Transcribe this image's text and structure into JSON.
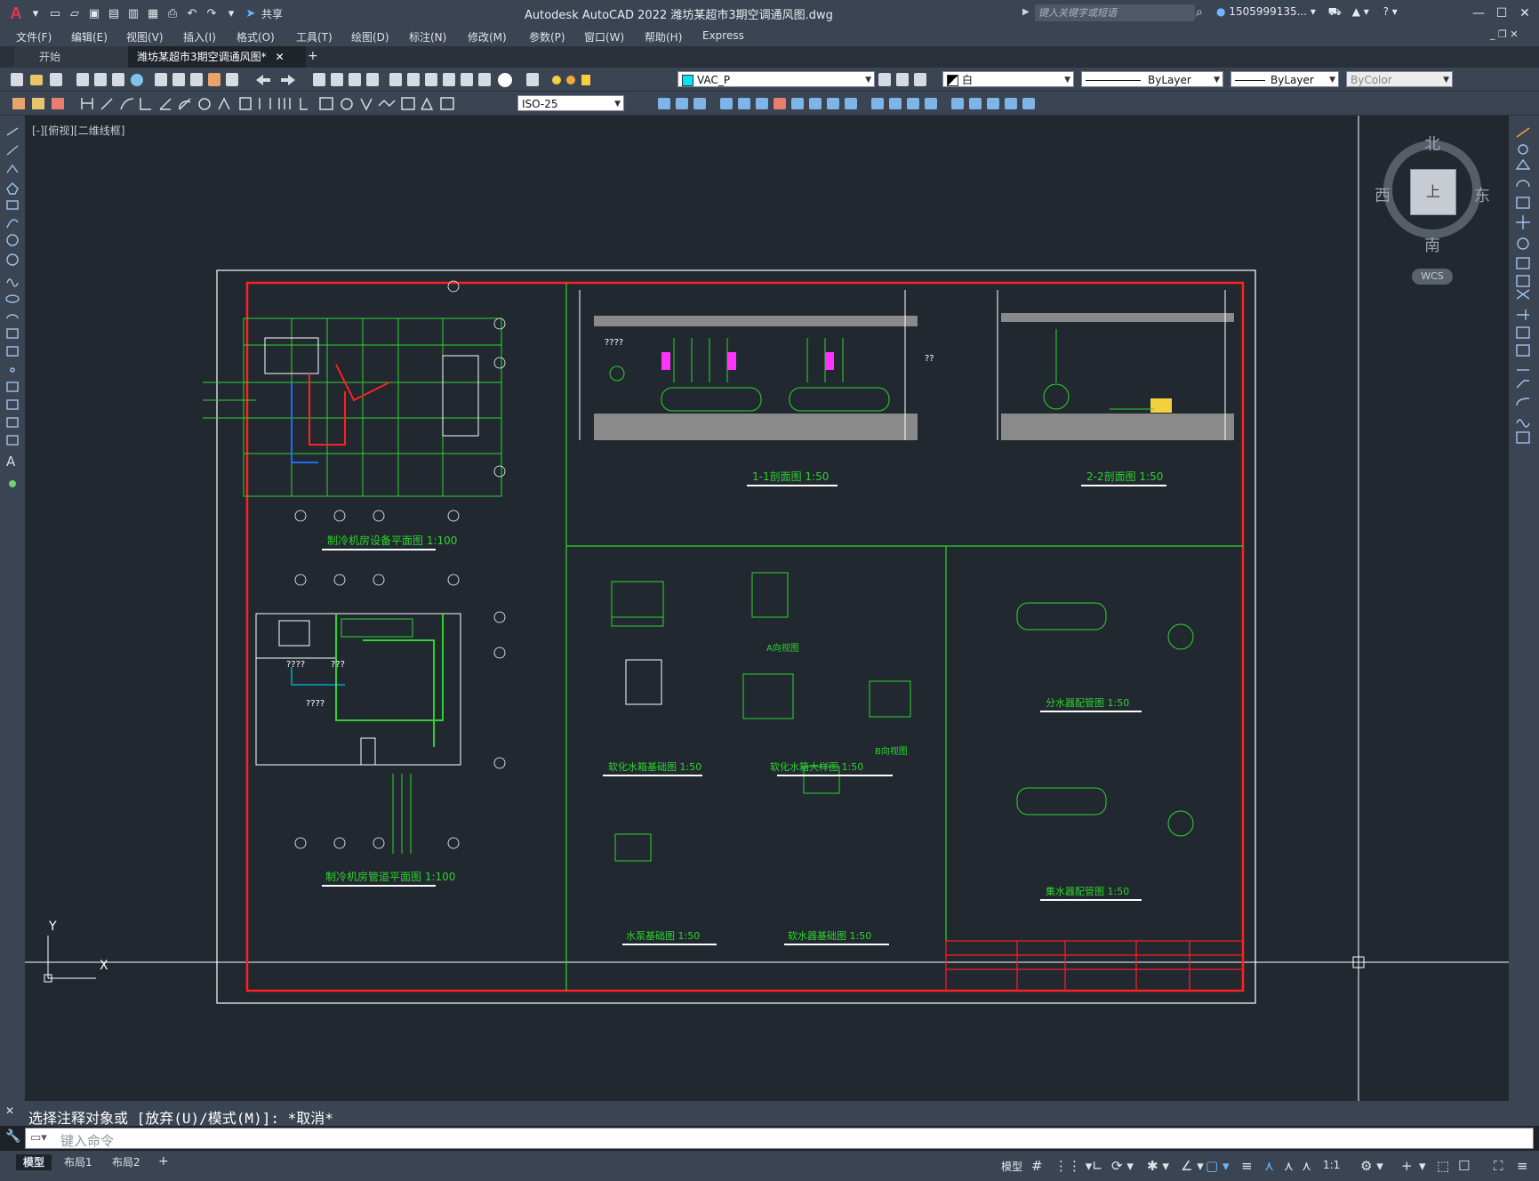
{
  "app": {
    "logo": "A",
    "title": "Autodesk AutoCAD 2022    潍坊某超市3期空调通风图.dwg",
    "share_label": "共享",
    "search_placeholder": "键入关键字或短语",
    "user": "1505999135...",
    "window_controls": [
      "minimize",
      "maximize",
      "close"
    ]
  },
  "menu": [
    "文件(F)",
    "编辑(E)",
    "视图(V)",
    "插入(I)",
    "格式(O)",
    "工具(T)",
    "绘图(D)",
    "标注(N)",
    "修改(M)",
    "参数(P)",
    "窗口(W)",
    "帮助(H)",
    "Express"
  ],
  "tabs": [
    {
      "label": "开始",
      "active": false
    },
    {
      "label": "潍坊某超市3期空调通风图*",
      "active": true
    }
  ],
  "toolbar": {
    "layer_combo": "VAC_P",
    "color_combo": "白",
    "linetype_combo": "ByLayer",
    "lineweight_combo": "ByLayer",
    "plotstyle_combo": "ByColor",
    "dimstyle_combo": "ISO-25"
  },
  "viewport": {
    "label": "[-][俯视][二维线框]",
    "viewcube": {
      "north": "北",
      "south": "南",
      "east": "东",
      "west": "西",
      "face": "上",
      "wcs": "WCS"
    },
    "ucs": {
      "x": "X",
      "y": "Y"
    }
  },
  "drawing": {
    "titles": {
      "plan_equipment": "制冷机房设备平面图  1:100",
      "plan_pipes": "制冷机房管道平面图  1:100",
      "section_1": "1-1剖面图   1:50",
      "section_2": "2-2剖面图   1:50",
      "softener_base": "软化水箱基础图  1:50",
      "softener_detail": "软化水箱大样图   1:50",
      "pump_base": "水泵基础图   1:50",
      "softener_equip_base": "软水器基础图   1:50",
      "distributor": "分水器配管图  1:50",
      "collector": "集水器配管图  1:50",
      "view_a": "A向视图",
      "view_b": "B向视图"
    },
    "notes": [
      "????",
      "????",
      "????",
      "??",
      "???"
    ]
  },
  "command": {
    "history": "选择注释对象或 [放弃(U)/模式(M)]: *取消*",
    "placeholder": "键入命令"
  },
  "status": {
    "layout_tabs": [
      "模型",
      "布局1",
      "布局2"
    ],
    "model_label": "模型",
    "scale": "1:1"
  }
}
